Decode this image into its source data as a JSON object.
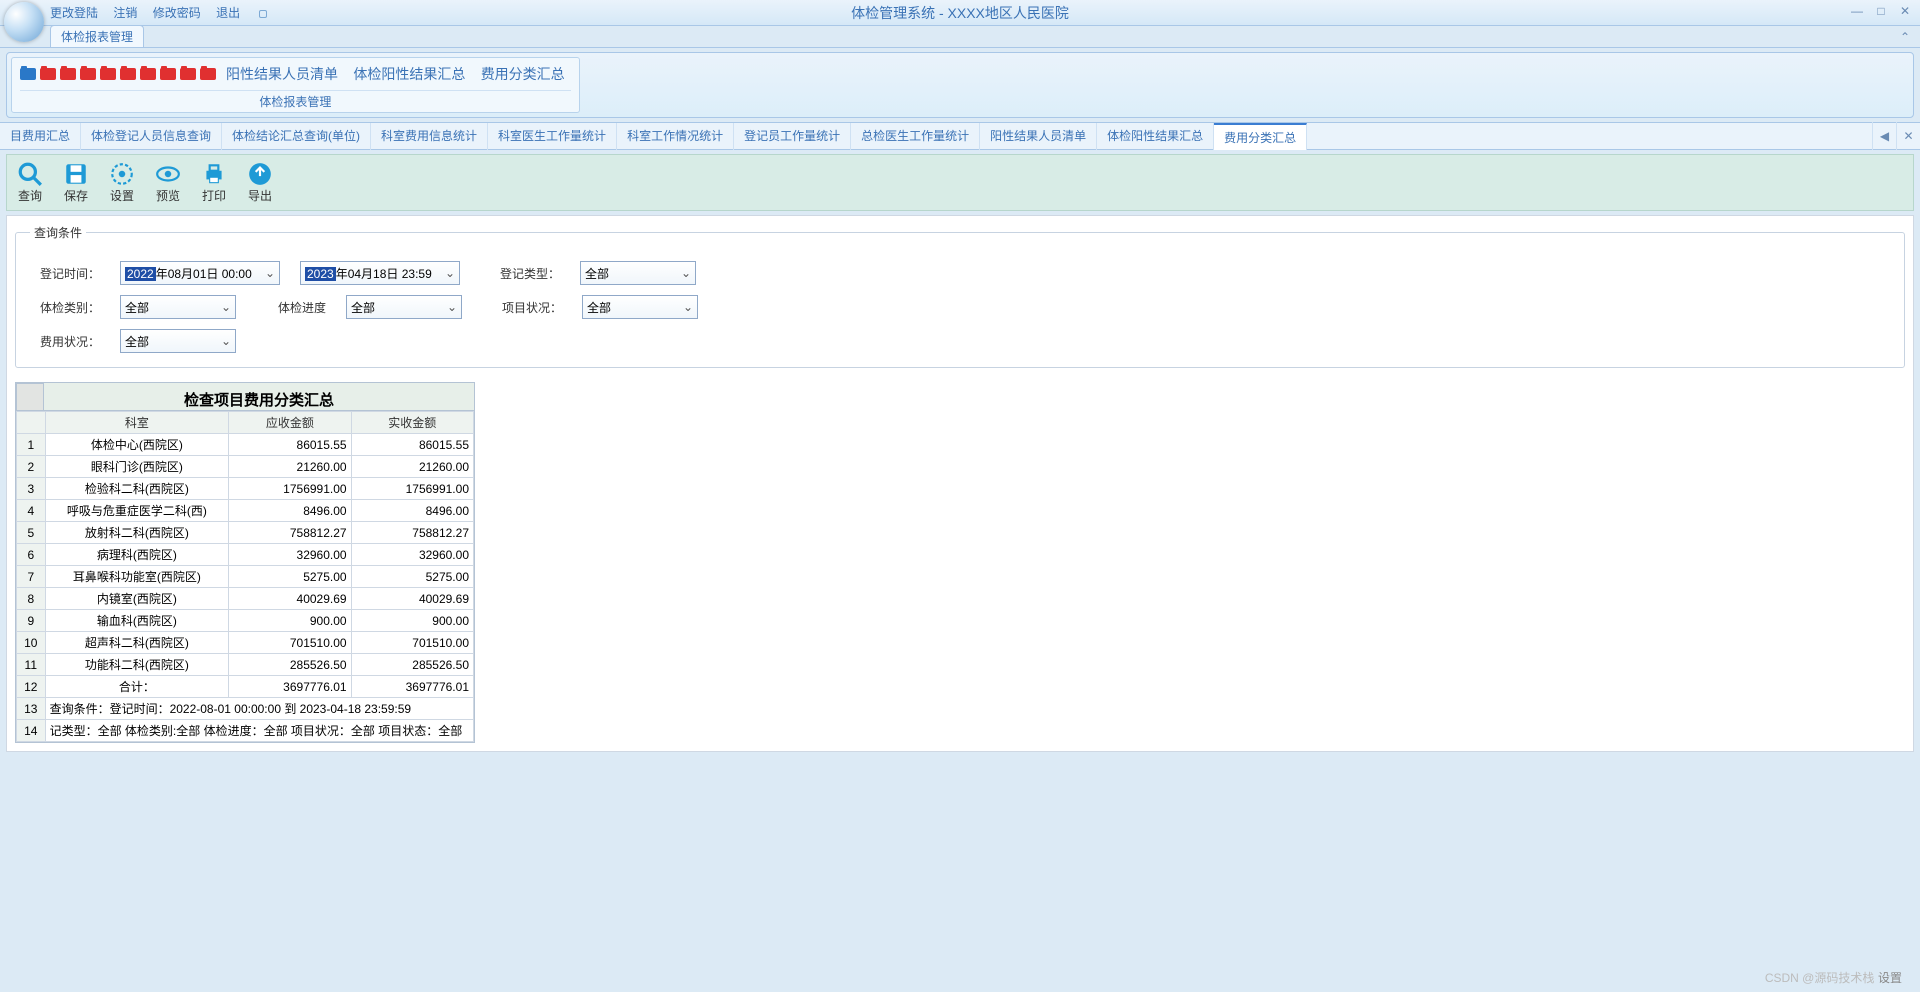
{
  "app": {
    "title": "体检管理系统   -   XXXX地区人民医院",
    "menu": [
      "更改登陆",
      "注销",
      "修改密码",
      "退出"
    ]
  },
  "ribbon": {
    "tab": "体检报表管理",
    "links": [
      "阳性结果人员清单",
      "体检阳性结果汇总",
      "费用分类汇总"
    ],
    "group_title": "体检报表管理"
  },
  "subtabs": {
    "items": [
      "目费用汇总",
      "体检登记人员信息查询",
      "体检结论汇总查询(单位)",
      "科室费用信息统计",
      "科室医生工作量统计",
      "科室工作情况统计",
      "登记员工作量统计",
      "总检医生工作量统计",
      "阳性结果人员清单",
      "体检阳性结果汇总",
      "费用分类汇总"
    ],
    "active_index": 10
  },
  "toolbar": {
    "items": [
      {
        "key": "query",
        "label": "查询"
      },
      {
        "key": "save",
        "label": "保存"
      },
      {
        "key": "setting",
        "label": "设置"
      },
      {
        "key": "preview",
        "label": "预览"
      },
      {
        "key": "print",
        "label": "打印"
      },
      {
        "key": "export",
        "label": "导出"
      }
    ]
  },
  "query": {
    "legend": "查询条件",
    "labels": {
      "reg_time": "登记时间：",
      "reg_type": "登记类型：",
      "exam_type": "体检类别：",
      "exam_progress": "体检进度",
      "item_status": "项目状况：",
      "fee_status": "费用状况："
    },
    "from": {
      "hl": "2022",
      "rest": "年08月01日 00:00"
    },
    "to": {
      "hl": "2023",
      "rest": "年04月18日 23:59"
    },
    "reg_type": "全部",
    "exam_type": "全部",
    "exam_progress": "全部",
    "item_status": "全部",
    "fee_status": "全部"
  },
  "chart_data": {
    "type": "table",
    "title": "检查项目费用分类汇总",
    "columns": [
      "科室",
      "应收金额",
      "实收金额"
    ],
    "rows": [
      {
        "n": 1,
        "dept": "体检中心(西院区)",
        "a": "86015.55",
        "b": "86015.55"
      },
      {
        "n": 2,
        "dept": "眼科门诊(西院区)",
        "a": "21260.00",
        "b": "21260.00"
      },
      {
        "n": 3,
        "dept": "检验科二科(西院区)",
        "a": "1756991.00",
        "b": "1756991.00"
      },
      {
        "n": 4,
        "dept": "呼吸与危重症医学二科(西)",
        "a": "8496.00",
        "b": "8496.00"
      },
      {
        "n": 5,
        "dept": "放射科二科(西院区)",
        "a": "758812.27",
        "b": "758812.27"
      },
      {
        "n": 6,
        "dept": "病理科(西院区)",
        "a": "32960.00",
        "b": "32960.00"
      },
      {
        "n": 7,
        "dept": "耳鼻喉科功能室(西院区)",
        "a": "5275.00",
        "b": "5275.00"
      },
      {
        "n": 8,
        "dept": "内镜室(西院区)",
        "a": "40029.69",
        "b": "40029.69"
      },
      {
        "n": 9,
        "dept": "输血科(西院区)",
        "a": "900.00",
        "b": "900.00"
      },
      {
        "n": 10,
        "dept": "超声科二科(西院区)",
        "a": "701510.00",
        "b": "701510.00"
      },
      {
        "n": 11,
        "dept": "功能科二科(西院区)",
        "a": "285526.50",
        "b": "285526.50"
      },
      {
        "n": 12,
        "dept": "合计：",
        "a": "3697776.01",
        "b": "3697776.01"
      }
    ],
    "footer1": {
      "n": 13,
      "text": "查询条件：登记时间：2022-08-01 00:00:00 到 2023-04-18 23:59:59"
    },
    "footer2": {
      "n": 14,
      "text": "记类型：全部 体检类别:全部 体检进度：全部 项目状况：全部 项目状态：全部"
    }
  },
  "watermark": "CSDN @源码技术栈",
  "watermark_right": "设置"
}
